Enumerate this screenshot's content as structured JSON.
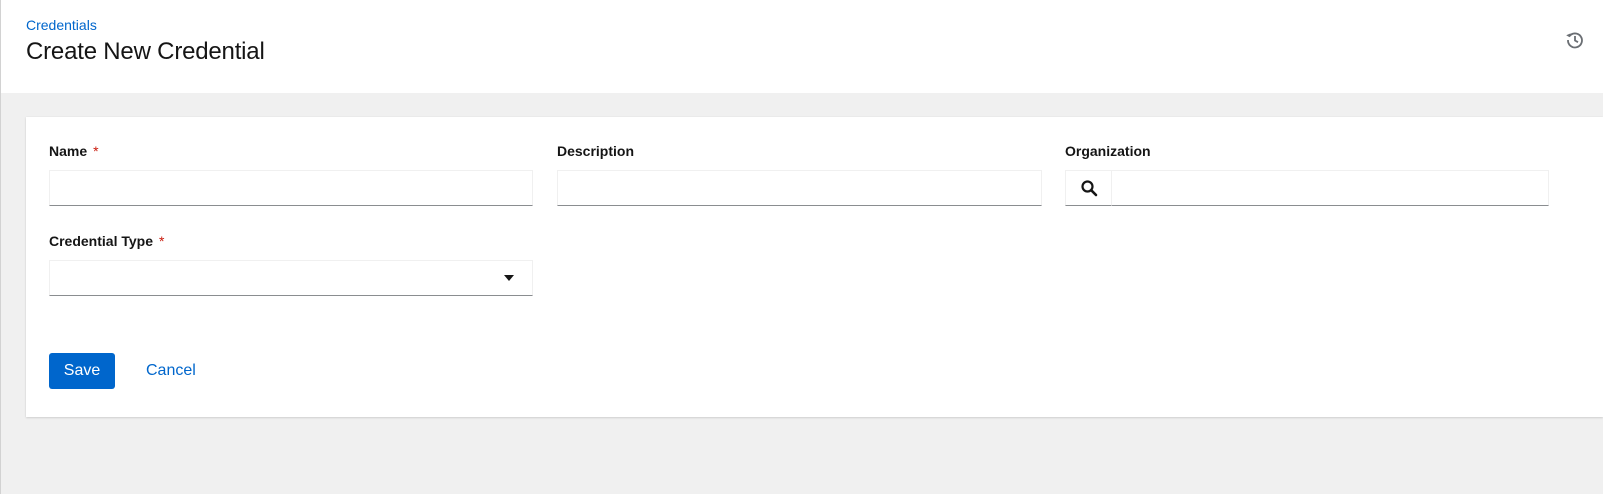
{
  "breadcrumb": {
    "label": "Credentials"
  },
  "page": {
    "title": "Create New Credential"
  },
  "header": {
    "history_icon": "history-icon"
  },
  "form": {
    "name": {
      "label": "Name",
      "required_marker": "*",
      "value": "",
      "placeholder": ""
    },
    "description": {
      "label": "Description",
      "value": "",
      "placeholder": ""
    },
    "organization": {
      "label": "Organization",
      "value": "",
      "placeholder": "",
      "search_icon": "search-icon"
    },
    "credential_type": {
      "label": "Credential Type",
      "required_marker": "*",
      "selected": ""
    }
  },
  "actions": {
    "save_label": "Save",
    "cancel_label": "Cancel"
  },
  "colors": {
    "accent": "#0066cc",
    "required": "#c9190b",
    "background": "#f0f0f0"
  }
}
